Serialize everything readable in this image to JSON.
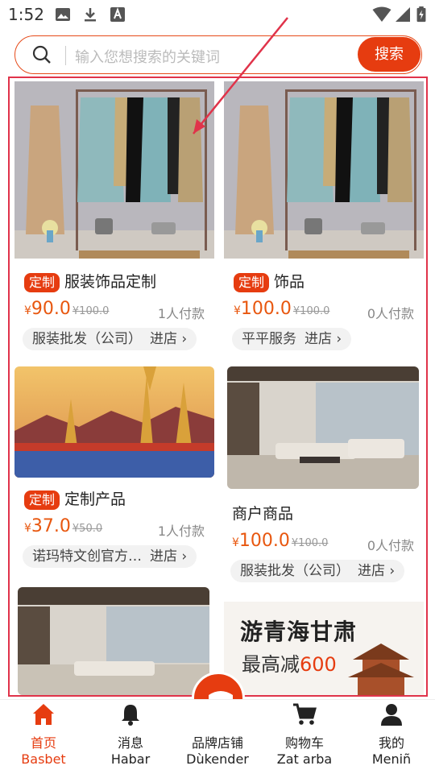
{
  "status_bar": {
    "time": "1:52",
    "icons": [
      "image-icon",
      "download-icon",
      "a-icon",
      "wifi-icon",
      "signal-icon",
      "battery-icon"
    ]
  },
  "search": {
    "placeholder": "输入您想搜索的关键词",
    "button_label": "搜索"
  },
  "products": [
    {
      "tag": "定制",
      "title": "服装饰品定制",
      "currency": "¥",
      "price": "90.0",
      "original": "¥100.0",
      "paid": "1人付款",
      "shop": "服装批发（公司）",
      "enter": "进店"
    },
    {
      "tag": "定制",
      "title": "饰品",
      "currency": "¥",
      "price": "100.0",
      "original": "¥100.0",
      "paid": "0人付款",
      "shop": "平平服务",
      "enter": "进店"
    },
    {
      "tag": "定制",
      "title": "定制产品",
      "currency": "¥",
      "price": "37.0",
      "original": "¥50.0",
      "paid": "1人付款",
      "shop": "诺玛特文创官方…",
      "enter": "进店"
    },
    {
      "tag": "",
      "title": "商户商品",
      "currency": "¥",
      "price": "100.0",
      "original": "¥100.0",
      "paid": "0人付款",
      "shop": "服装批发（公司）",
      "enter": "进店"
    }
  ],
  "promo_banner": {
    "line1": "游青海甘肃",
    "line2_prefix": "最高减",
    "line2_amount": "600"
  },
  "tabs": [
    {
      "label": "首页",
      "sub": "Basbet",
      "icon": "home-icon",
      "active": true
    },
    {
      "label": "消息",
      "sub": "Habar",
      "icon": "bell-icon",
      "active": false
    },
    {
      "label": "品牌店铺",
      "sub": "Dùkender",
      "icon": "store-icon",
      "active": false
    },
    {
      "label": "购物车",
      "sub": "Zat arba",
      "icon": "cart-icon",
      "active": false
    },
    {
      "label": "我的",
      "sub": "Meniñ",
      "icon": "user-icon",
      "active": false
    }
  ],
  "colors": {
    "accent": "#e63c10",
    "price": "#e8570f",
    "highlight_frame": "#e0334a"
  }
}
